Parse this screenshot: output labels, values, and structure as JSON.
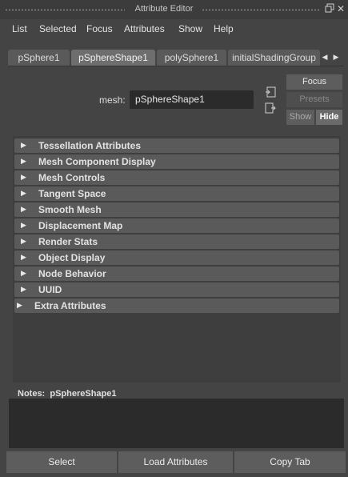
{
  "window": {
    "title": "Attribute Editor"
  },
  "menu": [
    "List",
    "Selected",
    "Focus",
    "Attributes",
    "Show",
    "Help"
  ],
  "tabs": [
    {
      "label": "pSphere1",
      "active": false
    },
    {
      "label": "pSphereShape1",
      "active": true
    },
    {
      "label": "polySphere1",
      "active": false
    },
    {
      "label": "initialShadingGroup",
      "active": false
    }
  ],
  "node": {
    "label": "mesh:",
    "value": "pSphereShape1"
  },
  "side_buttons": {
    "focus": "Focus",
    "presets": "Presets",
    "show": "Show",
    "hide": "Hide"
  },
  "sections": [
    "Tessellation Attributes",
    "Mesh Component Display",
    "Mesh Controls",
    "Tangent Space",
    "Smooth Mesh",
    "Displacement Map",
    "Render Stats",
    "Object Display",
    "Node Behavior",
    "UUID",
    "Extra Attributes"
  ],
  "notes": {
    "label": "Notes:",
    "node": "pSphereShape1",
    "value": ""
  },
  "bottom_buttons": {
    "select": "Select",
    "load": "Load Attributes",
    "copy": "Copy Tab"
  },
  "icons": {
    "title_float": "float-window-icon",
    "title_close": "close-icon",
    "tab_left": "triangle-left-icon",
    "tab_right": "triangle-right-icon",
    "section_expand": "triangle-right-icon",
    "input_connection": "input-connection-icon",
    "output_connection": "output-connection-icon"
  }
}
